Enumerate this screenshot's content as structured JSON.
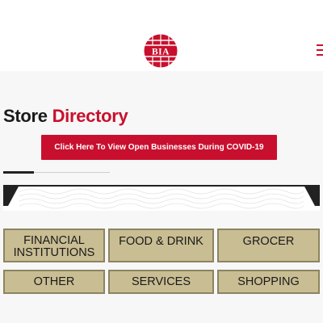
{
  "header": {
    "logo_text": "BIA",
    "menu_icon": "hamburger-menu-icon",
    "brand_color": "#c8102e"
  },
  "page": {
    "title_part1": "Store ",
    "title_part2": "Directory"
  },
  "covid_button": {
    "label": "Click Here To View Open Businesses During COVID-19"
  },
  "categories": [
    {
      "label": "FINANCIAL\nINSTITUTIONS"
    },
    {
      "label": "FOOD & DRINK"
    },
    {
      "label": "GROCER"
    },
    {
      "label": "OTHER"
    },
    {
      "label": "SERVICES"
    },
    {
      "label": "SHOPPING"
    }
  ],
  "colors": {
    "accent": "#c8102e",
    "tile_background": "#c9bd93",
    "tile_border": "#8c8462"
  }
}
